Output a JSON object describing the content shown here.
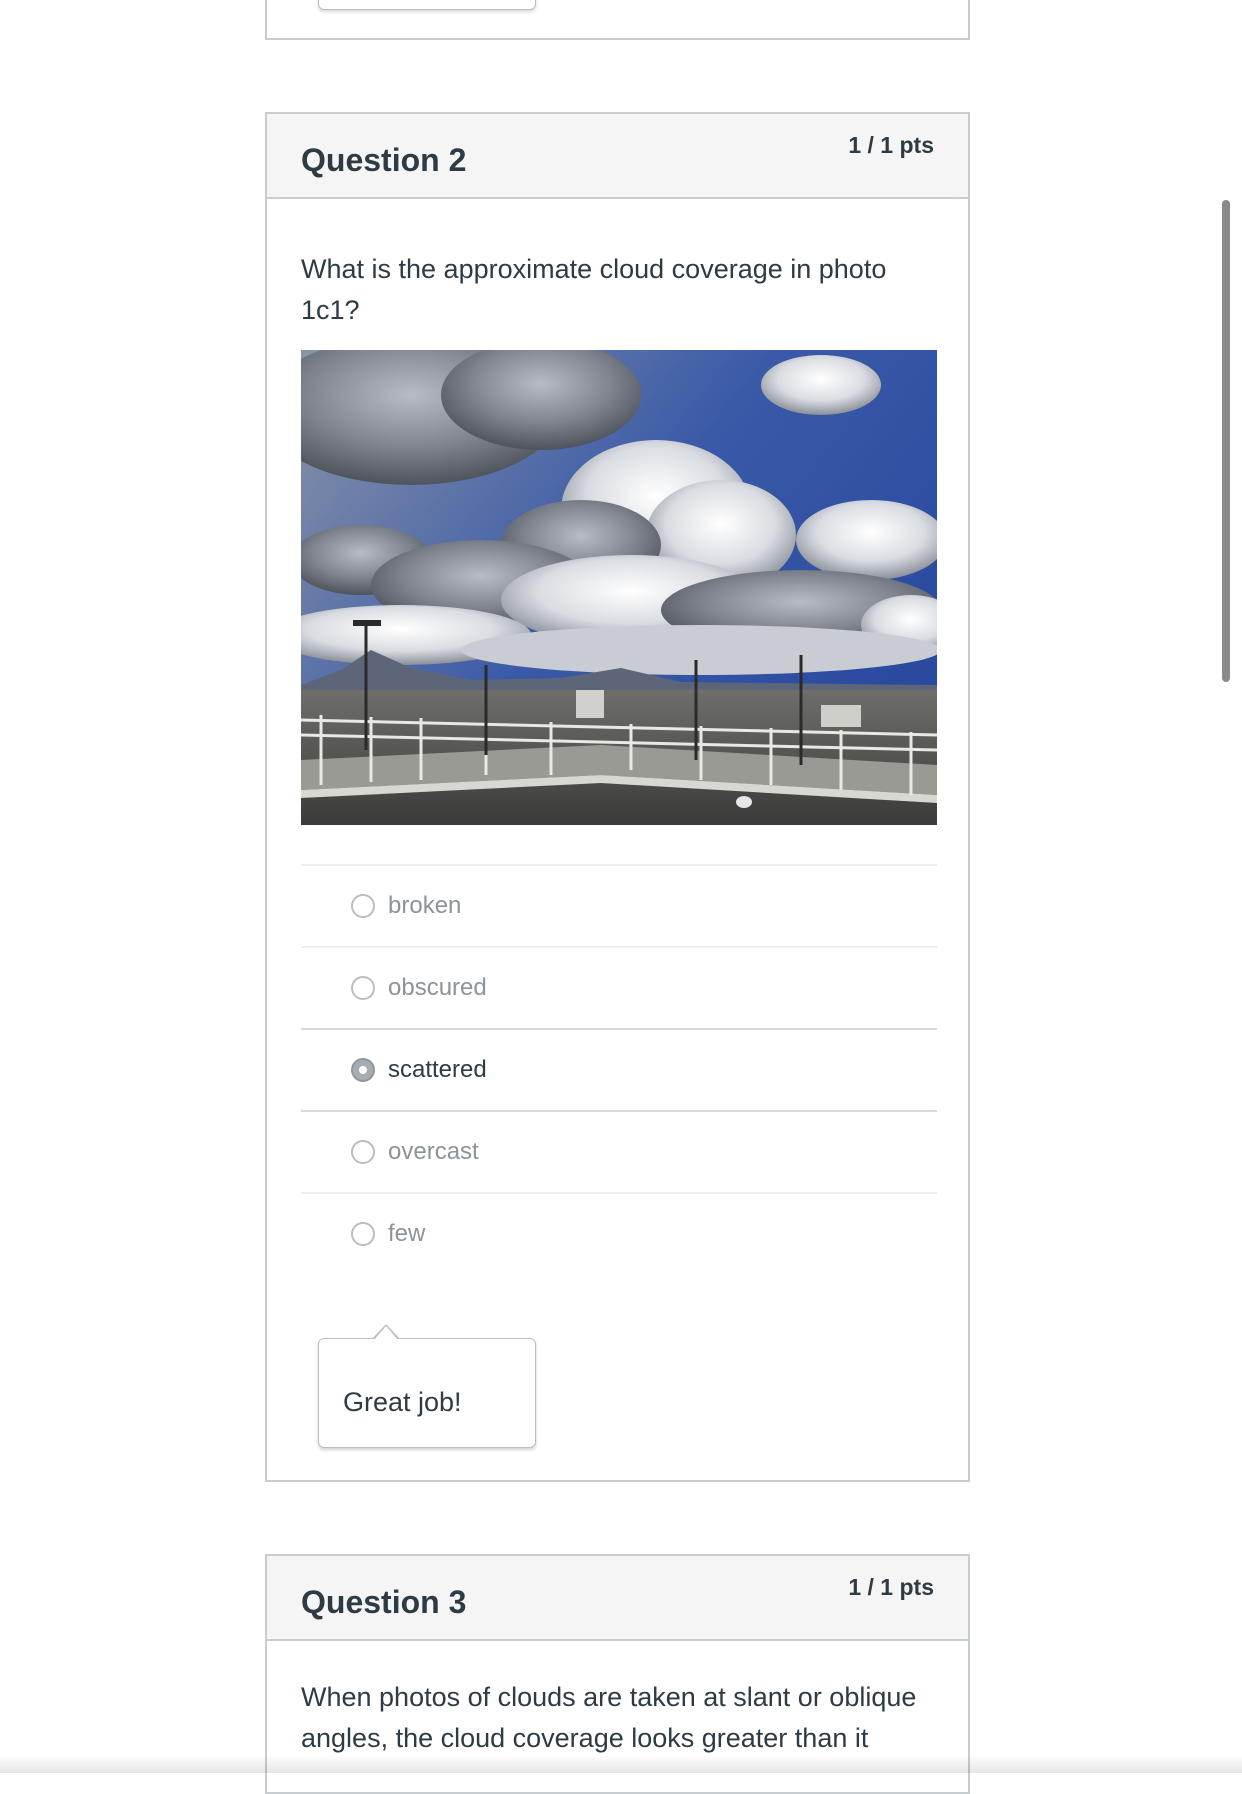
{
  "question2": {
    "title": "Question 2",
    "points": "1 / 1 pts",
    "text": "What is the approximate cloud coverage in photo 1c1?",
    "image_description_icon": "cloud-photo",
    "answers": [
      {
        "label": "broken",
        "selected": false
      },
      {
        "label": "obscured",
        "selected": false
      },
      {
        "label": "scattered",
        "selected": true
      },
      {
        "label": "overcast",
        "selected": false
      },
      {
        "label": "few",
        "selected": false
      }
    ],
    "feedback": "Great job!"
  },
  "question3": {
    "title": "Question 3",
    "points": "1 / 1 pts",
    "text": "When photos of clouds are taken at slant or oblique angles, the cloud coverage looks greater than it"
  },
  "colors": {
    "border": "#c7cdd1",
    "header_bg": "#f5f5f5",
    "text": "#2d3b45",
    "muted_text": "#8b949a"
  }
}
